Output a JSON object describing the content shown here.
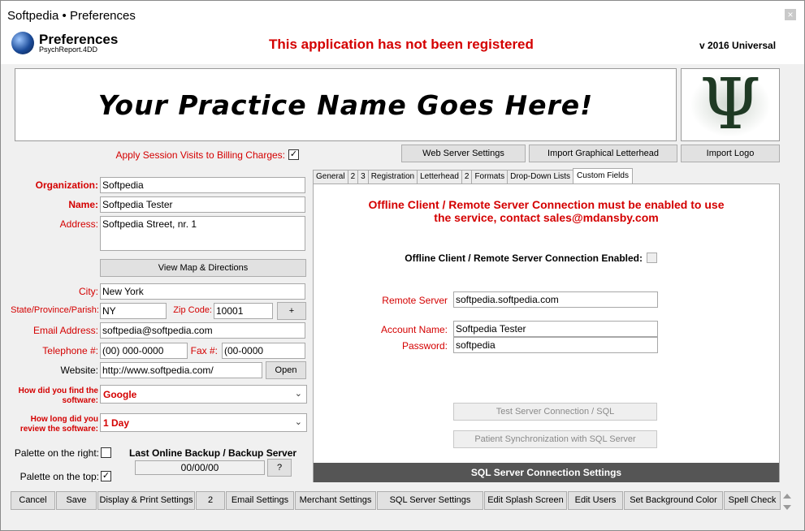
{
  "window": {
    "title": "Softpedia  • Preferences",
    "close": "×"
  },
  "header": {
    "title": "Preferences",
    "subtitle": "PsychReport.4DD",
    "warning": "This application has not been registered",
    "version": "v 2016 Universal"
  },
  "banner": {
    "practice_name": "Your Practice Name Goes Here!",
    "logo_symbol": "Ψ"
  },
  "top_buttons": {
    "web_server": "Web Server Settings",
    "import_letterhead": "Import Graphical Letterhead",
    "import_logo": "Import Logo"
  },
  "left": {
    "apply_session_label": "Apply Session Visits to Billing Charges:",
    "apply_session_checked": "✓",
    "organization_label": "Organization:",
    "organization": "Softpedia",
    "name_label": "Name:",
    "name": "Softpedia Tester",
    "address_label": "Address:",
    "address": "Softpedia Street, nr. 1",
    "view_map": "View Map & Directions",
    "city_label": "City:",
    "city": "New York",
    "state_label": "State/Province/Parish:",
    "state": "NY",
    "zip_label": "Zip Code:",
    "zip": "10001",
    "plus": "+",
    "email_label": "Email Address:",
    "email": "softpedia@softpedia.com",
    "telephone_label": "Telephone #:",
    "telephone": "(00) 000-0000",
    "fax_label": "Fax #:",
    "fax": "(00-0000",
    "website_label": "Website:",
    "website": "http://www.softpedia.com/",
    "open": "Open",
    "found_label_1": "How did you find the",
    "found_label_2": "software:",
    "found_value": "Google",
    "review_label_1": "How long did you",
    "review_label_2": "review the software:",
    "review_value": "1 Day",
    "palette_right_label": "Palette on the right:",
    "palette_right_checked": "",
    "palette_top_label": "Palette on the top:",
    "palette_top_checked": "✓",
    "backup_label": "Last Online Backup / Backup Server",
    "backup_value": "00/00/00",
    "backup_q": "?"
  },
  "tabs": [
    {
      "label": "General"
    },
    {
      "label": "2"
    },
    {
      "label": "3"
    },
    {
      "label": "Registration"
    },
    {
      "label": "Letterhead"
    },
    {
      "label": "2"
    },
    {
      "label": "Formats"
    },
    {
      "label": "Drop-Down Lists"
    },
    {
      "label": "Custom Fields"
    }
  ],
  "panel": {
    "warning_1": "Offline Client / Remote Server Connection must be enabled to use",
    "warning_2": "the service, contact sales@mdansby.com",
    "offline_label": "Offline Client / Remote Server Connection Enabled:",
    "remote_server_label": "Remote Server",
    "remote_server": "softpedia.softpedia.com",
    "account_label": "Account Name:",
    "account": "Softpedia Tester",
    "password_label": "Password:",
    "password": "softpedia",
    "test_conn": "Test Server Connection / SQL",
    "patient_sync": "Patient Synchronization with SQL Server",
    "sql_settings": "SQL Server Connection Settings"
  },
  "bottom": {
    "cancel": "Cancel",
    "save": "Save",
    "display_print": "Display & Print Settings",
    "two": "2",
    "email": "Email Settings",
    "merchant": "Merchant Settings",
    "sql": "SQL Server Settings",
    "splash": "Edit Splash Screen",
    "users": "Edit Users",
    "background": "Set Background Color",
    "spell": "Spell Check"
  }
}
